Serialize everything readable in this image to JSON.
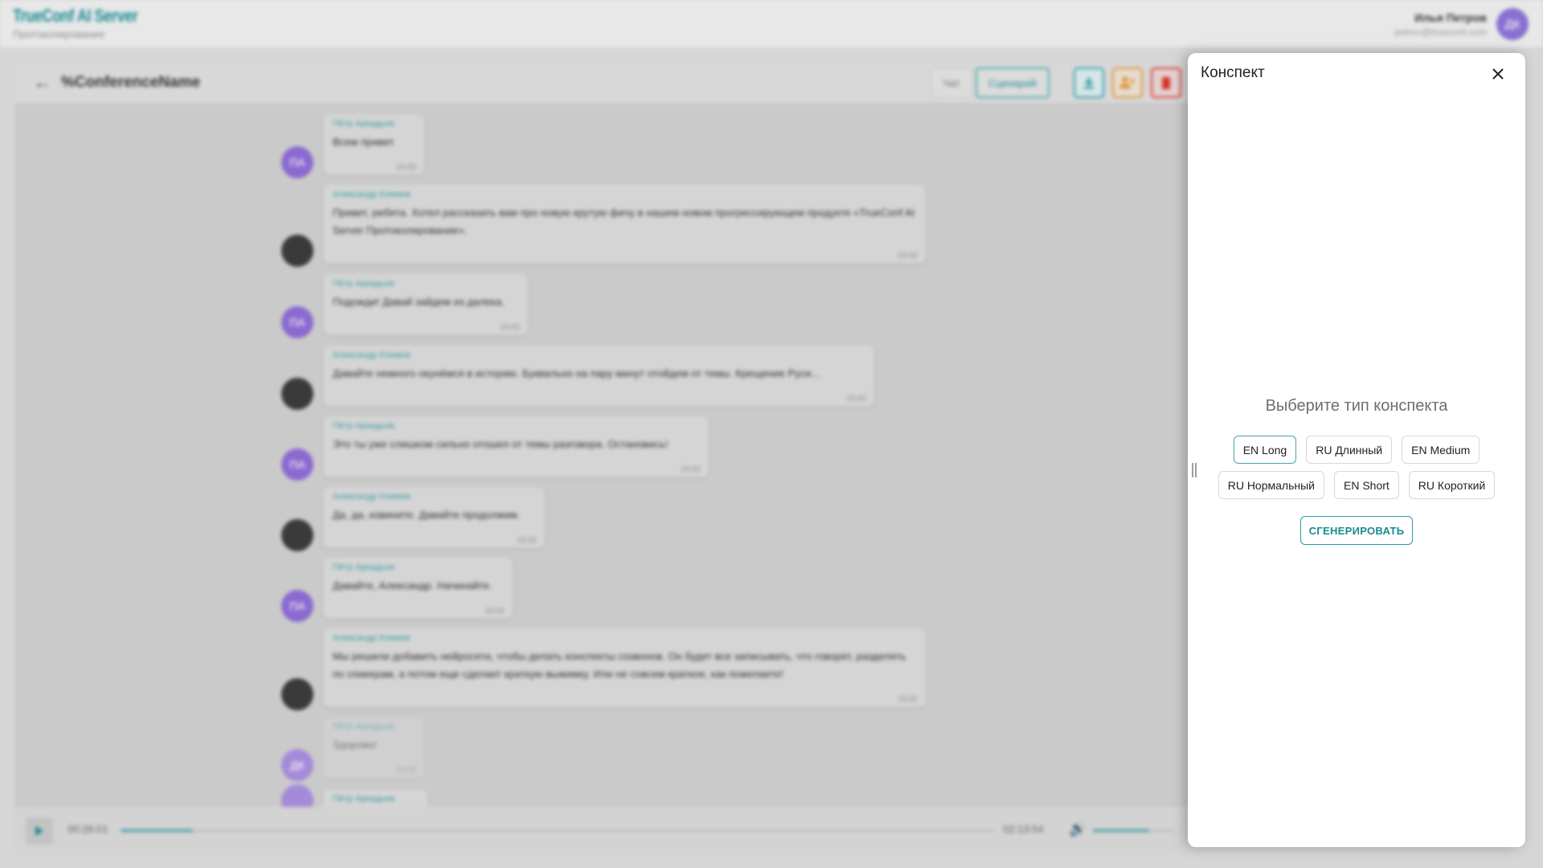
{
  "app": {
    "logo_title": "TrueConf AI Server",
    "logo_subtitle": "Протоколирование",
    "user_name": "Илья Петров",
    "user_email": "petrov@trueconf.com",
    "user_initials": "ДК"
  },
  "conference": {
    "title": "%ConferenceName",
    "tabs": [
      "Чат",
      "Сценарий"
    ],
    "active_tab": "Сценарий"
  },
  "messages": [
    {
      "author": "Пётр Аркадьев",
      "initials": "ПА",
      "avatar_color": "#8b6ad0",
      "text": "Всем привет.",
      "time": "15:02"
    },
    {
      "author": "Александр Климов",
      "initials": "",
      "avatar_color": "#3a3a3a",
      "text": "Привет, ребята. Хотел рассказать вам про новую крутую фичу в нашем новом прогрессирующем продукте «TrueConf AI Server Протоколирование».",
      "time": "15:02"
    },
    {
      "author": "Пётр Аркадьев",
      "initials": "ПА",
      "avatar_color": "#8b6ad0",
      "text": "Подожди! Давай зайдем из далека.",
      "time": "15:02"
    },
    {
      "author": "Александр Климов",
      "initials": "",
      "avatar_color": "#3a3a3a",
      "text": "Давайте немного окунёмся в историю. Буквально на пару минут отойдем от темы. Крещение Руси...",
      "time": "15:02"
    },
    {
      "author": "Пётр Аркадьев",
      "initials": "ПА",
      "avatar_color": "#8b6ad0",
      "text": "Это ты уже слишком сильно отошел от темы разговора. Остановись!",
      "time": "15:02"
    },
    {
      "author": "Александр Климов",
      "initials": "",
      "avatar_color": "#3a3a3a",
      "text": "Да, да, извините. Давайте продолжим.",
      "time": "15:02"
    },
    {
      "author": "Пётр Аркадьев",
      "initials": "ПА",
      "avatar_color": "#8b6ad0",
      "text": "Давайте, Александр. Начинайте.",
      "time": "15:02"
    },
    {
      "author": "Александр Климов",
      "initials": "",
      "avatar_color": "#3a3a3a",
      "text": "Мы решили добавить нейросети, чтобы делать конспекты созвонов. Он будет все записывать, что говорят, разделять по спикерам, а потом еще сделает краткую выжимку. Или не совсем краткое, как пожелаете!",
      "time": "15:02"
    },
    {
      "author": "Пётр Аркадьев",
      "initials": "ДК",
      "avatar_color": "#a48ad8",
      "text": "Здорово!",
      "time": "15:02"
    },
    {
      "author": "Пётр Аркадьев",
      "initials": "",
      "avatar_color": "#a48ad8",
      "text": "",
      "time": ""
    }
  ],
  "player": {
    "current_time": "00:26:01",
    "total_time": "02:13:54",
    "progress": 0.083,
    "volume": 0.7
  },
  "panel": {
    "title": "Конспект",
    "prompt": "Выберите тип конспекта",
    "types": [
      "EN Long",
      "RU Длинный",
      "EN Medium",
      "RU Нормальный",
      "EN Short",
      "RU Короткий"
    ],
    "selected_type": "EN Long",
    "generate_label": "СГЕНЕРИРОВАТЬ"
  },
  "colors": {
    "accent": "#1a8a94",
    "download": "#2a9aa4",
    "add_user": "#e0902a",
    "delete": "#d9302a"
  }
}
